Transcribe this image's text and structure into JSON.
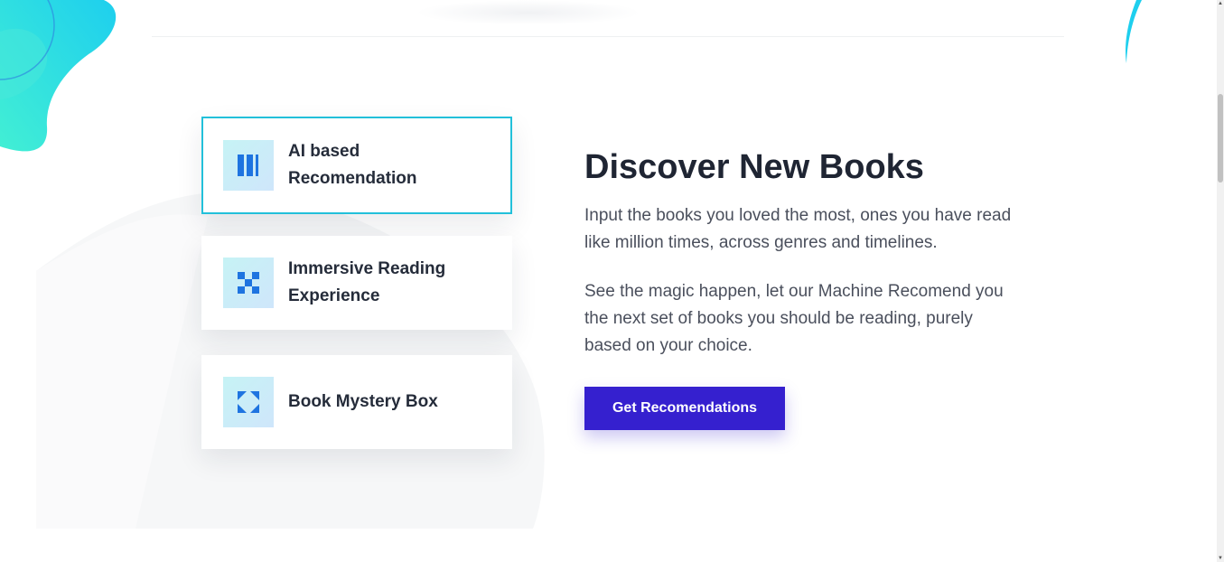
{
  "features": [
    {
      "label_line1": "AI based",
      "label_line2": "Recomendation",
      "icon": "bars-icon",
      "active": true
    },
    {
      "label_line1": "Immersive Reading",
      "label_line2": "Experience",
      "icon": "checker-icon",
      "active": false
    },
    {
      "label_line1": "Book Mystery Box",
      "label_line2": "",
      "icon": "corners-icon",
      "active": false
    }
  ],
  "section": {
    "title": "Discover New Books",
    "paragraph1": "Input the books you loved the most, ones you have read like million times, across genres and timelines.",
    "paragraph2": "See the magic happen, let our Machine Recomend you the next set of books you should be reading, purely based on your choice.",
    "cta_label": "Get Recomendations"
  },
  "colors": {
    "accent_border": "#22c0da",
    "button": "#3520cf",
    "icon_blue": "#1e74e0",
    "heading": "#1f2533",
    "body_text": "#4a4f5c"
  }
}
